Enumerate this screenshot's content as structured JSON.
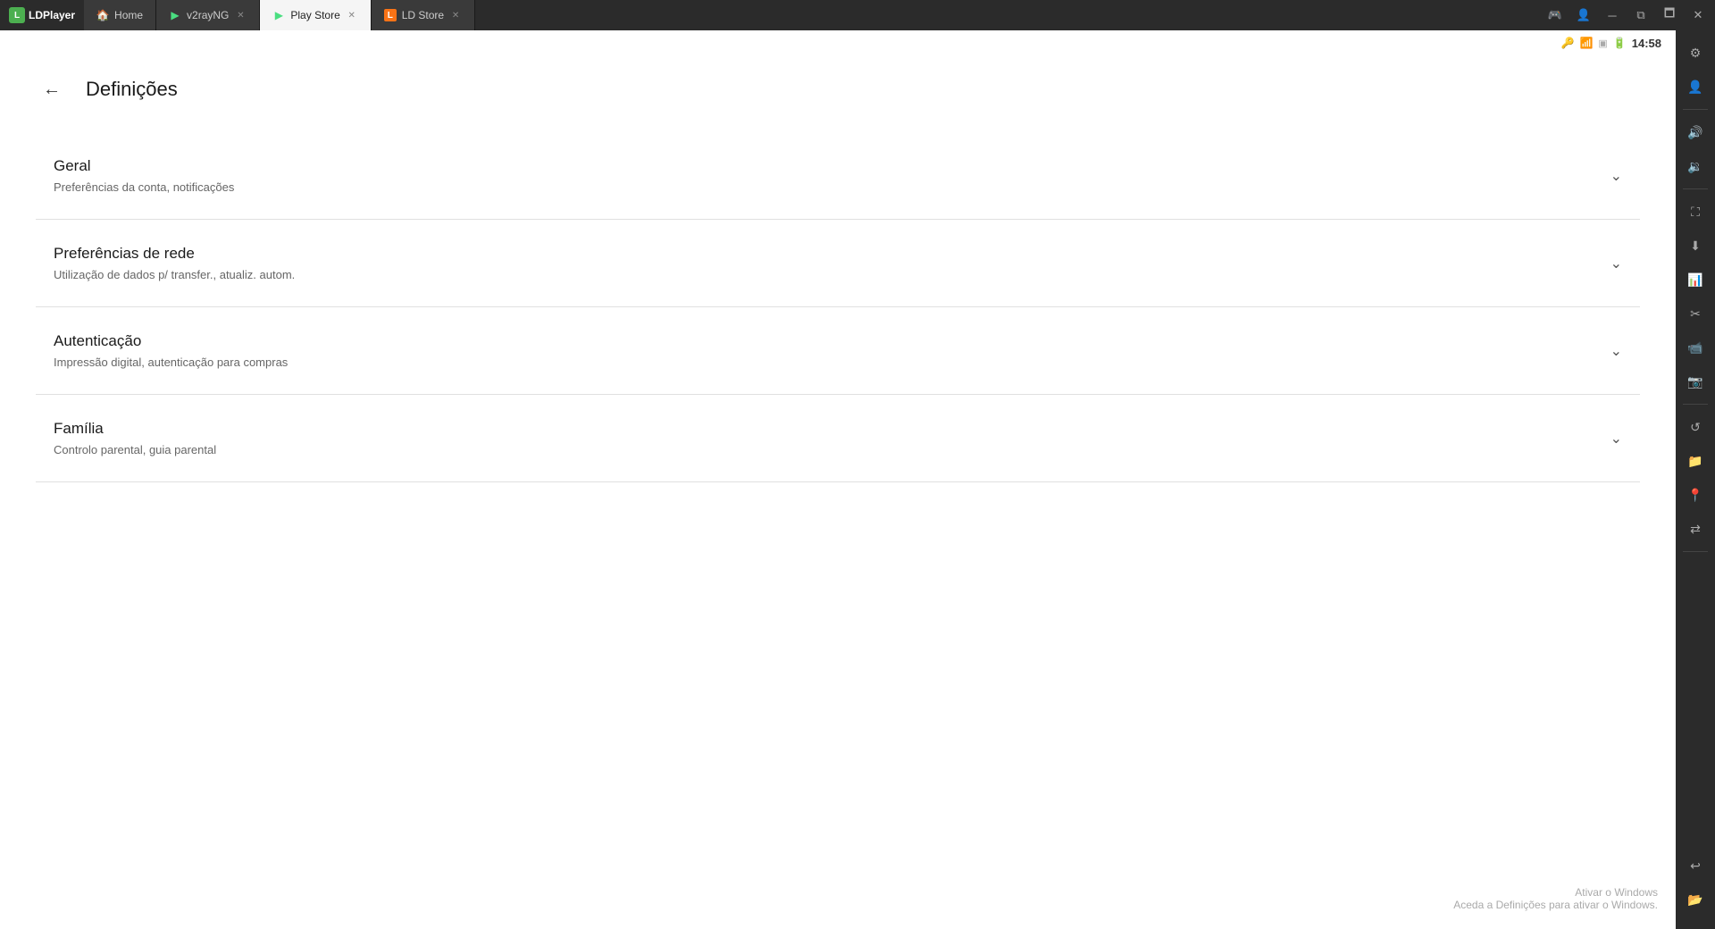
{
  "titlebar": {
    "logo": "LDPlayer",
    "tabs": [
      {
        "id": "home",
        "label": "Home",
        "icon": "🏠",
        "active": false,
        "closable": false
      },
      {
        "id": "v2rayng",
        "label": "v2rayNG",
        "icon": "▶",
        "active": false,
        "closable": true
      },
      {
        "id": "playstore",
        "label": "Play Store",
        "icon": "▶",
        "active": true,
        "closable": true
      },
      {
        "id": "ldstore",
        "label": "LD Store",
        "icon": "🅛",
        "active": false,
        "closable": true
      }
    ],
    "controls": [
      "minimize",
      "maximize",
      "restore",
      "close"
    ]
  },
  "statusbar": {
    "time": "14:58",
    "icons": [
      "vpn",
      "wifi",
      "no-signal",
      "battery"
    ]
  },
  "settings": {
    "title": "Definições",
    "sections": [
      {
        "id": "geral",
        "title": "Geral",
        "subtitle": "Preferências da conta, notificações"
      },
      {
        "id": "rede",
        "title": "Preferências de rede",
        "subtitle": "Utilização de dados p/ transfer., atualiz. autom."
      },
      {
        "id": "autenticacao",
        "title": "Autenticação",
        "subtitle": "Impressão digital, autenticação para compras"
      },
      {
        "id": "familia",
        "title": "Família",
        "subtitle": "Controlo parental, guia parental"
      }
    ]
  },
  "watermark": {
    "line1": "Ativar o Windows",
    "line2": "Aceda a Definições para ativar o Windows."
  },
  "sidebar": {
    "buttons": [
      {
        "id": "settings",
        "icon": "⚙"
      },
      {
        "id": "user",
        "icon": "👤"
      },
      {
        "id": "volume-up",
        "icon": "🔊"
      },
      {
        "id": "volume-down",
        "icon": "🔉"
      },
      {
        "id": "fullscreen",
        "icon": "⛶"
      },
      {
        "id": "download",
        "icon": "⬇"
      },
      {
        "id": "chart",
        "icon": "📊"
      },
      {
        "id": "scissors",
        "icon": "✂"
      },
      {
        "id": "video",
        "icon": "📹"
      },
      {
        "id": "camera",
        "icon": "📷"
      },
      {
        "id": "refresh",
        "icon": "↺"
      },
      {
        "id": "folder",
        "icon": "📁"
      },
      {
        "id": "location",
        "icon": "📍"
      },
      {
        "id": "share",
        "icon": "⇄"
      },
      {
        "id": "back",
        "icon": "↩"
      },
      {
        "id": "folder2",
        "icon": "📂"
      }
    ]
  }
}
